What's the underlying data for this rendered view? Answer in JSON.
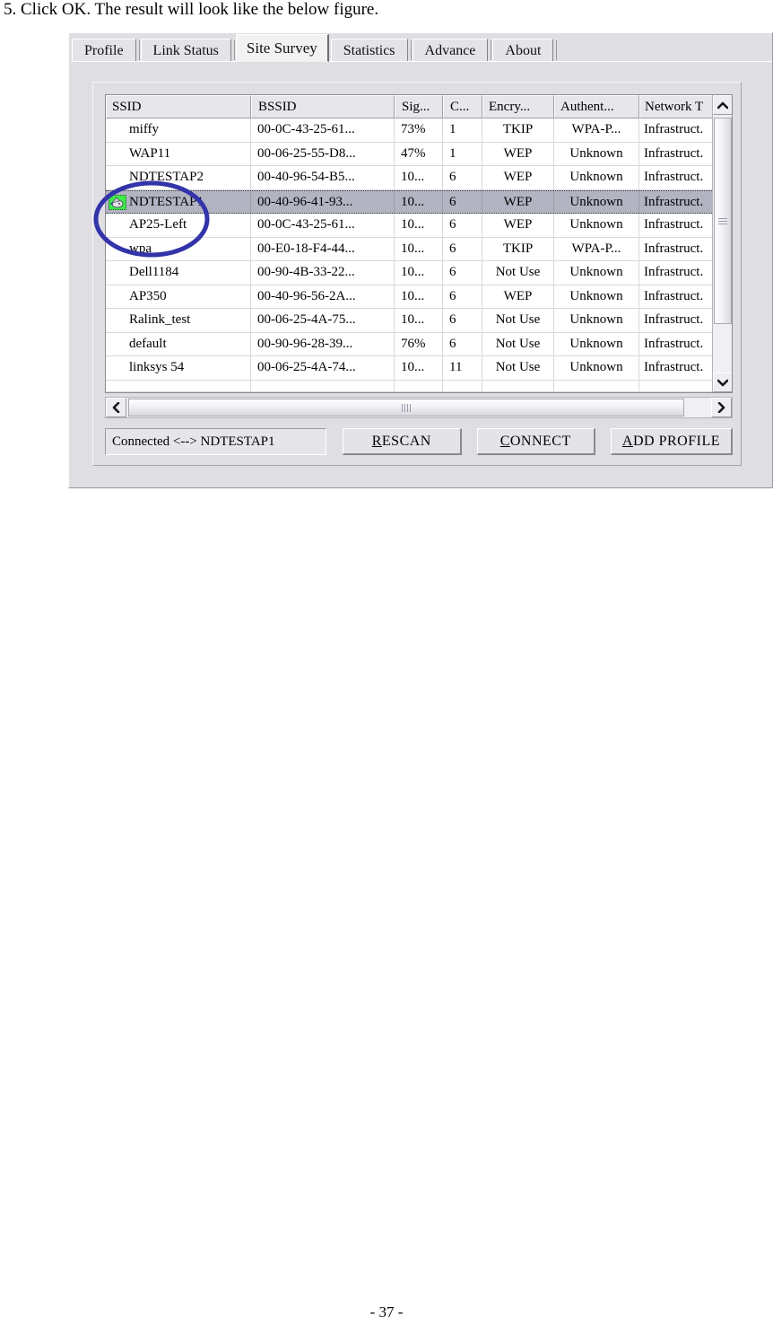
{
  "document": {
    "instruction": "5. Click OK. The result will look like the below figure.",
    "page_number": "- 37 -"
  },
  "window": {
    "tabs": [
      {
        "label": "Profile",
        "active": false
      },
      {
        "label": "Link Status",
        "active": false
      },
      {
        "label": "Site Survey",
        "active": true
      },
      {
        "label": "Statistics",
        "active": false
      },
      {
        "label": "Advance",
        "active": false
      },
      {
        "label": "About",
        "active": false
      }
    ]
  },
  "site_survey": {
    "columns": [
      {
        "key": "ssid",
        "label": "SSID"
      },
      {
        "key": "bssid",
        "label": "BSSID"
      },
      {
        "key": "signal",
        "label": "Sig..."
      },
      {
        "key": "channel",
        "label": "C..."
      },
      {
        "key": "encrypt",
        "label": "Encry..."
      },
      {
        "key": "auth",
        "label": "Authent..."
      },
      {
        "key": "network",
        "label": "Network T"
      }
    ],
    "rows": [
      {
        "ssid": "miffy",
        "bssid": "00-0C-43-25-61...",
        "signal": "73%",
        "channel": "1",
        "encrypt": "TKIP",
        "auth": "WPA-P...",
        "network": "Infrastruct.",
        "selected": false,
        "connected": false
      },
      {
        "ssid": "WAP11",
        "bssid": "00-06-25-55-D8...",
        "signal": "47%",
        "channel": "1",
        "encrypt": "WEP",
        "auth": "Unknown",
        "network": "Infrastruct.",
        "selected": false,
        "connected": false
      },
      {
        "ssid": "NDTESTAP2",
        "bssid": "00-40-96-54-B5...",
        "signal": "10...",
        "channel": "6",
        "encrypt": "WEP",
        "auth": "Unknown",
        "network": "Infrastruct.",
        "selected": false,
        "connected": false
      },
      {
        "ssid": "NDTESTAP1",
        "bssid": "00-40-96-41-93...",
        "signal": "10...",
        "channel": "6",
        "encrypt": "WEP",
        "auth": "Unknown",
        "network": "Infrastruct.",
        "selected": true,
        "connected": true
      },
      {
        "ssid": "AP25-Left",
        "bssid": "00-0C-43-25-61...",
        "signal": "10...",
        "channel": "6",
        "encrypt": "WEP",
        "auth": "Unknown",
        "network": "Infrastruct.",
        "selected": false,
        "connected": false
      },
      {
        "ssid": "wpa",
        "bssid": "00-E0-18-F4-44...",
        "signal": "10...",
        "channel": "6",
        "encrypt": "TKIP",
        "auth": "WPA-P...",
        "network": "Infrastruct.",
        "selected": false,
        "connected": false
      },
      {
        "ssid": "Dell1184",
        "bssid": "00-90-4B-33-22...",
        "signal": "10...",
        "channel": "6",
        "encrypt": "Not Use",
        "auth": "Unknown",
        "network": "Infrastruct.",
        "selected": false,
        "connected": false
      },
      {
        "ssid": "AP350",
        "bssid": "00-40-96-56-2A...",
        "signal": "10...",
        "channel": "6",
        "encrypt": "WEP",
        "auth": "Unknown",
        "network": "Infrastruct.",
        "selected": false,
        "connected": false
      },
      {
        "ssid": "Ralink_test",
        "bssid": "00-06-25-4A-75...",
        "signal": "10...",
        "channel": "6",
        "encrypt": "Not Use",
        "auth": "Unknown",
        "network": "Infrastruct.",
        "selected": false,
        "connected": false
      },
      {
        "ssid": "default",
        "bssid": "00-90-96-28-39...",
        "signal": "76%",
        "channel": "6",
        "encrypt": "Not Use",
        "auth": "Unknown",
        "network": "Infrastruct.",
        "selected": false,
        "connected": false
      },
      {
        "ssid": "linksys 54",
        "bssid": "00-06-25-4A-74...",
        "signal": "10...",
        "channel": "11",
        "encrypt": "Not Use",
        "auth": "Unknown",
        "network": "Infrastruct.",
        "selected": false,
        "connected": false
      }
    ],
    "status_text": "Connected <--> NDTESTAP1",
    "buttons": {
      "rescan": {
        "accel": "R",
        "rest": "ESCAN"
      },
      "connect": {
        "accel": "C",
        "rest": "ONNECT"
      },
      "add_profile": {
        "accel": "A",
        "rest": "DD PROFILE"
      }
    }
  },
  "annotation": {
    "shape": "ellipse",
    "color": "#3333aa",
    "target": "NDTESTAP1"
  }
}
